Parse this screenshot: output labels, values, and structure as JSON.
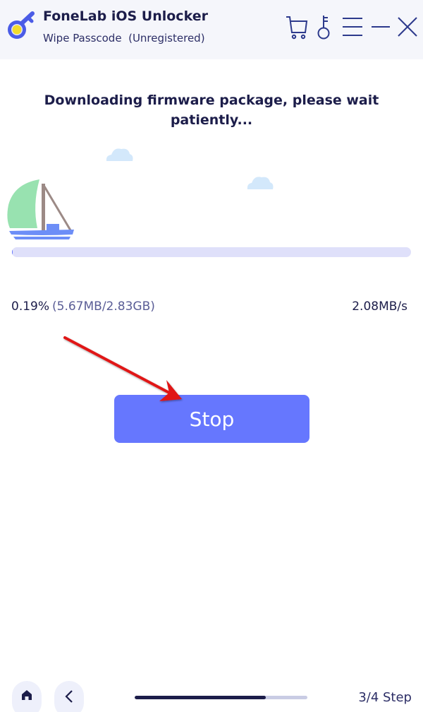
{
  "app": {
    "title": "FoneLab iOS Unlocker",
    "subtitle": "Wipe Passcode  (Unregistered)",
    "logo_icon": "key-logo-icon"
  },
  "header_icons": [
    {
      "name": "cart-icon",
      "label": "Purchase"
    },
    {
      "name": "key-icon",
      "label": "Register"
    },
    {
      "name": "menu-icon",
      "label": "Menu"
    },
    {
      "name": "minimize-icon",
      "label": "Minimize"
    },
    {
      "name": "close-icon",
      "label": "Close"
    }
  ],
  "main": {
    "headline": "Downloading firmware package, please wait patiently...",
    "progress": {
      "percent_text": "0.19%",
      "size_text": "(5.67MB/2.83GB)",
      "speed_text": "2.08MB/s",
      "fraction": 0.0019
    },
    "stop_button": {
      "label": "Stop"
    }
  },
  "footer": {
    "home_icon": "home-icon",
    "back_icon": "chevron-left-icon",
    "step_label": "3/4 Step",
    "step_fraction": 0.76
  },
  "colors": {
    "accent": "#6677fe",
    "title_text": "#1c1d4a",
    "track": "#dfe0fa",
    "sail": "#98e2b0",
    "hull": "#6d8ef7",
    "mast": "#9c8a86",
    "cloud": "#d3e8fb",
    "annotation_arrow": "#e01414"
  }
}
